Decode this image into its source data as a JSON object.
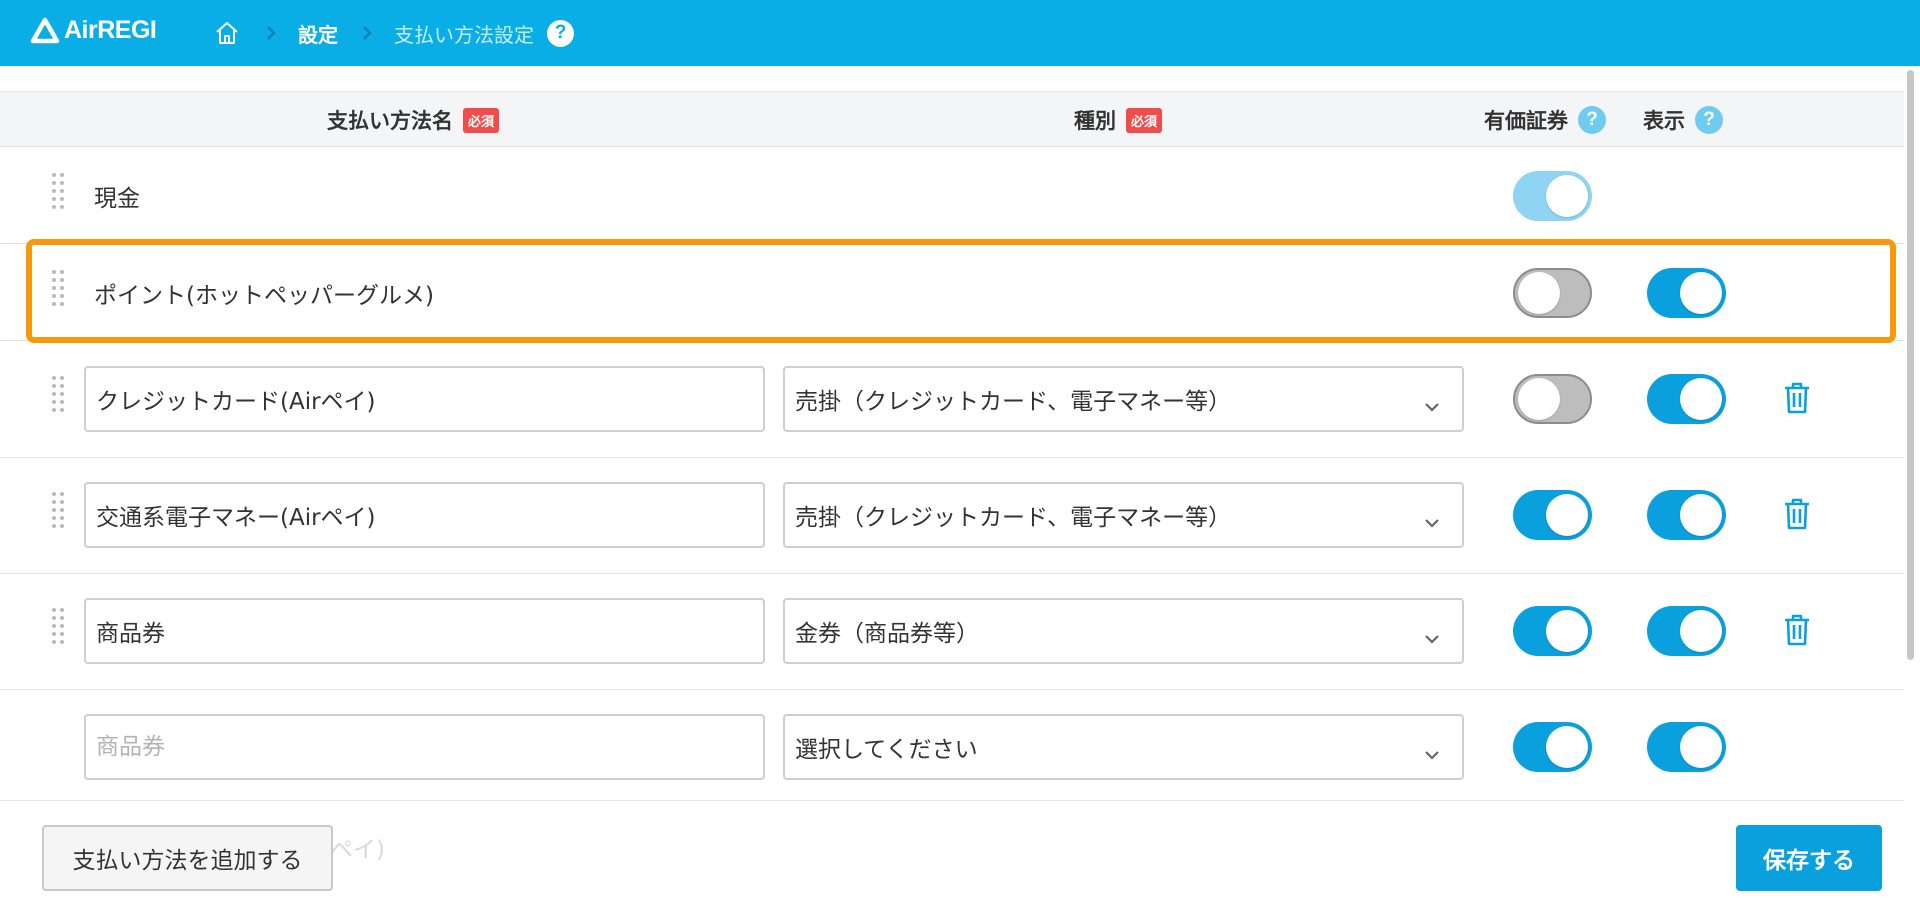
{
  "app": {
    "logo_text": "AirREGI",
    "brand_color": "#0aaee6"
  },
  "breadcrumb": {
    "home_icon": "home-icon",
    "current": "設定",
    "page": "支払い方法設定",
    "help": "?"
  },
  "table": {
    "headers": {
      "name": "支払い方法名",
      "type": "種別",
      "securities": "有価証券",
      "display": "表示",
      "required_badge": "必須",
      "help": "?"
    },
    "rows": [
      {
        "name": "現金",
        "editable": false,
        "securities": "on-disabled",
        "display": null,
        "deletable": false
      },
      {
        "name": "ポイント(ホットペッパーグルメ)",
        "editable": false,
        "securities": "off",
        "display": "on",
        "deletable": false,
        "highlighted": true
      },
      {
        "name": "クレジットカード(Airペイ)",
        "editable": true,
        "type": "売掛（クレジットカード、電子マネー等）",
        "securities": "off",
        "display": "on",
        "deletable": true
      },
      {
        "name": "交通系電子マネー(Airペイ)",
        "editable": true,
        "type": "売掛（クレジットカード、電子マネー等）",
        "securities": "on",
        "display": "on",
        "deletable": true
      },
      {
        "name": "商品券",
        "editable": true,
        "type": "金券（商品券等）",
        "securities": "on",
        "display": "on",
        "deletable": true
      },
      {
        "name": "",
        "placeholder": "商品券",
        "editable": true,
        "type": "選択してください",
        "securities": "on",
        "display": "on",
        "deletable": false
      }
    ]
  },
  "footer": {
    "add_button": "支払い方法を追加する",
    "save_button": "保存する",
    "ghost_text": "ペイ)"
  },
  "colors": {
    "toggle_on": "#0aa0de",
    "toggle_off": "#bdbdbd",
    "highlight": "#f7990c",
    "required": "#f14c4c"
  }
}
